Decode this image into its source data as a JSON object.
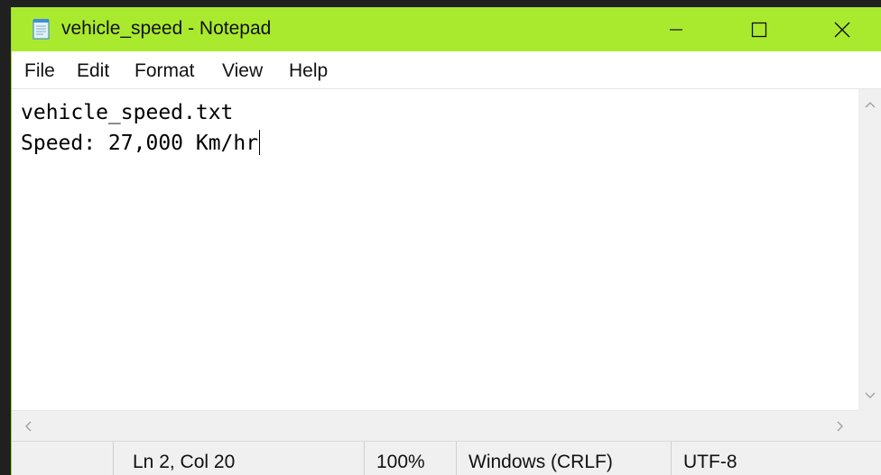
{
  "window": {
    "title": "vehicle_speed - Notepad",
    "titlebar_color": "#aaea2e"
  },
  "menu": [
    "File",
    "Edit",
    "Format",
    "View",
    "Help"
  ],
  "editor": {
    "lines": [
      "vehicle_speed.txt",
      "Speed: 27,000 Km/hr"
    ]
  },
  "status": {
    "position": "Ln 2, Col 20",
    "zoom": "100%",
    "line_ending": "Windows (CRLF)",
    "encoding": "UTF-8"
  },
  "icons": {
    "app": "notepad-icon",
    "minimize": "minimize-icon",
    "maximize": "maximize-icon",
    "close": "close-icon"
  }
}
